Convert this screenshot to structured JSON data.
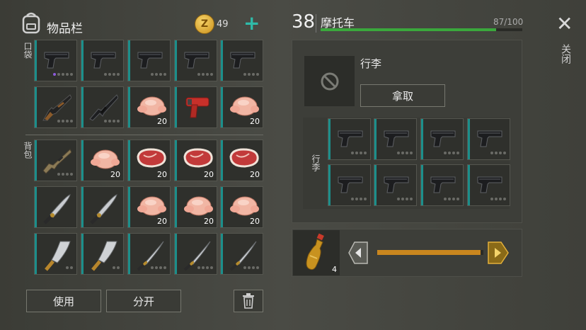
{
  "inventory": {
    "title": "物品栏",
    "coins": "49",
    "coin_symbol": "Z",
    "add_symbol": "+",
    "pocket_label": "口袋",
    "backpack_label": "背包",
    "pocket_rows": [
      [
        {
          "item": "pistol",
          "count": "",
          "dots": "p4"
        },
        {
          "item": "pistol",
          "count": "",
          "dots": "4"
        },
        {
          "item": "pistol",
          "count": "",
          "dots": "4"
        },
        {
          "item": "pistol",
          "count": "",
          "dots": "4"
        },
        {
          "item": "pistol",
          "count": "",
          "dots": "4"
        }
      ],
      [
        {
          "item": "shotgun",
          "count": "",
          "dots": "4"
        },
        {
          "item": "rifle",
          "count": "",
          "dots": "4"
        },
        {
          "item": "chicken",
          "count": "20",
          "dots": ""
        },
        {
          "item": "flaregun",
          "count": "",
          "dots": ""
        },
        {
          "item": "chicken",
          "count": "20",
          "dots": ""
        }
      ]
    ],
    "backpack_rows": [
      [
        {
          "item": "rifle2",
          "count": "",
          "dots": "4"
        },
        {
          "item": "chicken",
          "count": "20",
          "dots": ""
        },
        {
          "item": "steak",
          "count": "20",
          "dots": ""
        },
        {
          "item": "steak",
          "count": "20",
          "dots": ""
        },
        {
          "item": "steak",
          "count": "20",
          "dots": ""
        }
      ],
      [
        {
          "item": "machete",
          "count": "",
          "dots": ""
        },
        {
          "item": "machete",
          "count": "",
          "dots": ""
        },
        {
          "item": "chicken",
          "count": "20",
          "dots": ""
        },
        {
          "item": "chicken",
          "count": "20",
          "dots": ""
        },
        {
          "item": "chicken",
          "count": "20",
          "dots": ""
        }
      ],
      [
        {
          "item": "cleaver",
          "count": "",
          "dots": "2"
        },
        {
          "item": "cleaver",
          "count": "",
          "dots": "2"
        },
        {
          "item": "katana",
          "count": "",
          "dots": "4"
        },
        {
          "item": "katana",
          "count": "",
          "dots": "4"
        },
        {
          "item": "katana",
          "count": "",
          "dots": "4"
        }
      ]
    ],
    "use_button": "使用",
    "split_button": "分开"
  },
  "vehicle": {
    "level": "38",
    "name": "摩托车",
    "durability_text": "87/100",
    "durability_fraction": 0.87,
    "luggage_label": "行李",
    "take_button": "拿取",
    "luggage_section_label": "行李",
    "luggage_slots": [
      "pistol",
      "pistol",
      "pistol",
      "pistol",
      "pistol",
      "pistol",
      "pistol",
      "pistol"
    ]
  },
  "transfer": {
    "item": "bottle",
    "count": "4",
    "slider_fraction": 0.97
  },
  "close_label": "关闭",
  "close_symbol": "✕",
  "colors": {
    "teal": "#1c8f8b",
    "durability": "#3aa83c",
    "slider": "#c9861e"
  }
}
